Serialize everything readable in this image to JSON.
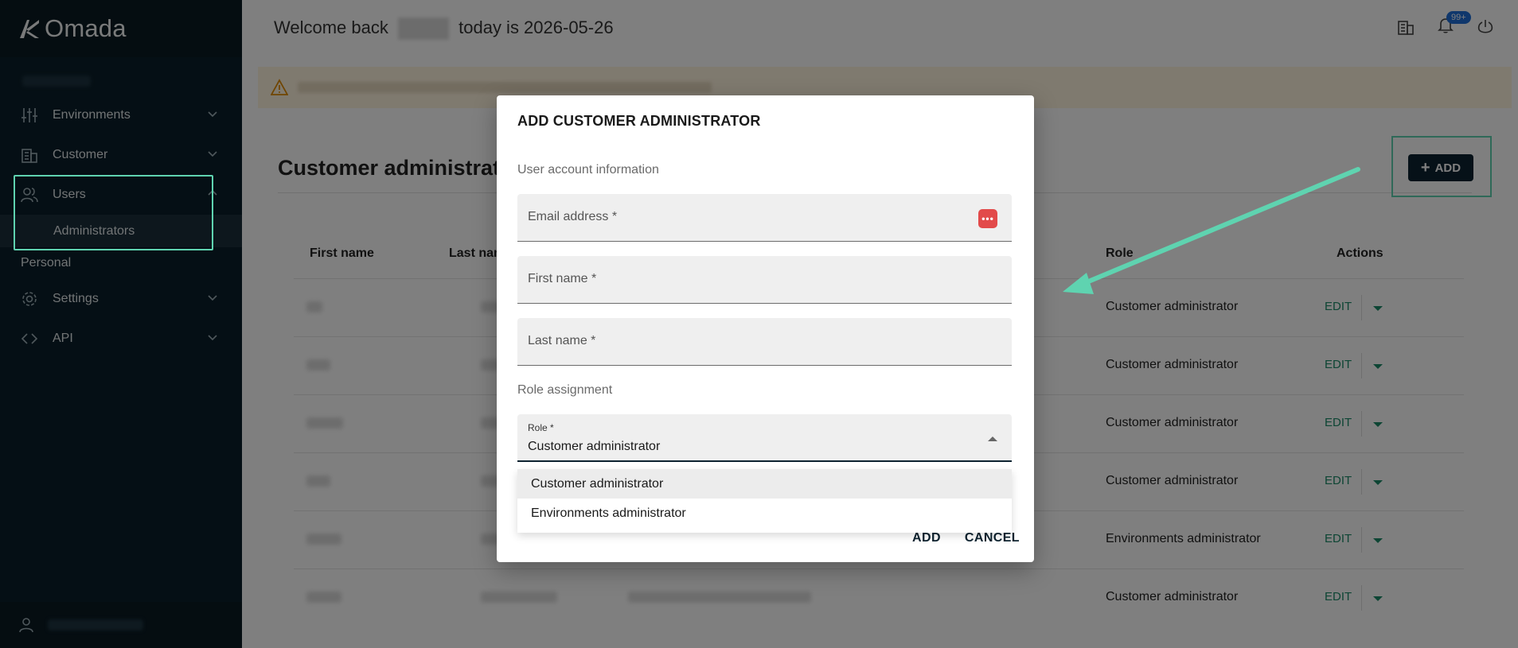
{
  "app": {
    "name": "Omada"
  },
  "sidebar": {
    "items": [
      {
        "label": "Environments",
        "icon": "sliders-icon"
      },
      {
        "label": "Customer",
        "icon": "building-icon"
      },
      {
        "label": "Users",
        "icon": "users-icon"
      }
    ],
    "subitem": "Administrators",
    "section": "Personal",
    "items2": [
      {
        "label": "Settings",
        "icon": "gear-icon"
      },
      {
        "label": "API",
        "icon": "code-icon"
      }
    ]
  },
  "header": {
    "welcome_prefix": "Welcome back",
    "welcome_suffix": "today is 2026-05-26",
    "notification_badge": "99+"
  },
  "page": {
    "title": "Customer administrators",
    "add_label": "ADD"
  },
  "table": {
    "columns": [
      "First name",
      "Last name",
      "Role",
      "Actions"
    ],
    "rows": [
      {
        "role": "Customer administrator",
        "action": "EDIT"
      },
      {
        "role": "Customer administrator",
        "action": "EDIT"
      },
      {
        "role": "Customer administrator",
        "action": "EDIT"
      },
      {
        "role": "Customer administrator",
        "action": "EDIT"
      },
      {
        "role": "Environments administrator",
        "action": "EDIT"
      },
      {
        "role": "Customer administrator",
        "action": "EDIT"
      }
    ]
  },
  "modal": {
    "title": "ADD CUSTOMER ADMINISTRATOR",
    "section_user": "User account information",
    "email_label": "Email address *",
    "first_name_label": "First name *",
    "last_name_label": "Last name *",
    "section_role": "Role assignment",
    "role_label": "Role *",
    "role_value": "Customer administrator",
    "options": [
      "Customer administrator",
      "Environments administrator"
    ],
    "add_label": "ADD",
    "cancel_label": "CANCEL"
  },
  "colors": {
    "accent": "#5fd3b0",
    "sidebar_bg": "#0b1f2a",
    "edit": "#1b8a68"
  }
}
